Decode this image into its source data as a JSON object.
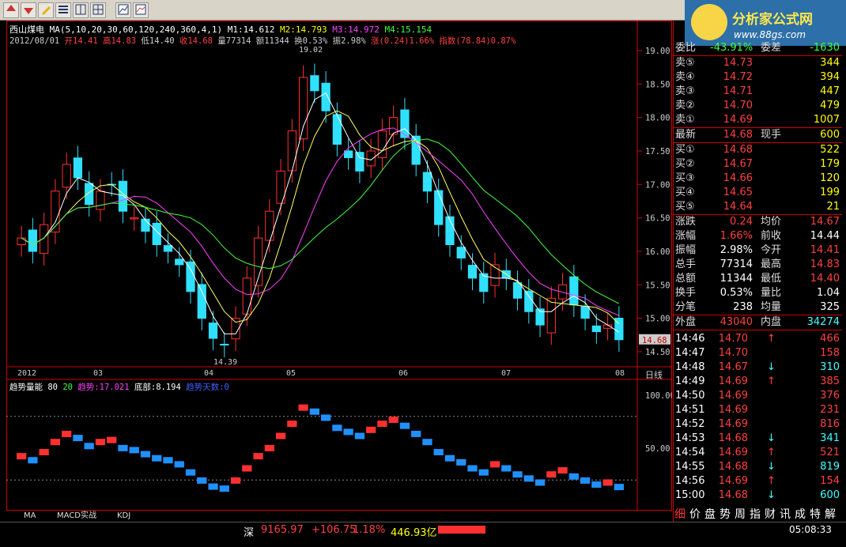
{
  "toolbar": {
    "icons": [
      "arrow-up-icon",
      "arrow-down-icon",
      "pen-icon",
      "list-icon",
      "split-icon",
      "grid-icon",
      "chart-icon",
      "window-icon",
      "graph-icon"
    ]
  },
  "logo": {
    "title": "分析家公式网",
    "url": "www.88gs.com"
  },
  "stock": {
    "name": "西山煤电",
    "ma_params": "MA(5,10,20,30,60,120,240,360,4,1)",
    "m1": "M1:14.612",
    "m2": "M2:14.793",
    "m3": "M3:14.972",
    "m4": "M4:15.154"
  },
  "bar_info": {
    "date": "2012/08/01",
    "open": "开14.41",
    "high": "高14.83",
    "low": "低14.40",
    "close": "收14.68",
    "vol": "量77314",
    "amount": "额11344",
    "turnover": "换0.53%",
    "amp": "振2.98%",
    "change": "涨(0.24)1.66%",
    "index": "指数(78.84)0.87%"
  },
  "indicator": {
    "name": "趋势量能",
    "p1": "80",
    "p2": "20",
    "trend": "趋势:17.021",
    "bottom": "底部:8.194",
    "days": "趋势天数:0"
  },
  "chart_data": {
    "type": "line",
    "title": "西山煤电",
    "y_ticks": [
      "19.00",
      "18.50",
      "18.00",
      "17.50",
      "17.00",
      "16.50",
      "16.00",
      "15.50",
      "15.00",
      "14.50"
    ],
    "annotations": [
      "19.02",
      "14.39"
    ],
    "current_price_tag": "14.68",
    "x_months": [
      "2012",
      "03",
      "04",
      "05",
      "06",
      "07",
      "08"
    ],
    "period": "日线",
    "indicator_ticks": [
      "100.00",
      "50.00"
    ],
    "close_series": [
      16.2,
      16.0,
      16.4,
      16.9,
      17.3,
      17.1,
      16.7,
      16.9,
      17.0,
      16.6,
      16.5,
      16.3,
      16.1,
      16.0,
      15.8,
      15.4,
      15.0,
      14.7,
      14.6,
      15.0,
      15.6,
      16.2,
      16.6,
      17.2,
      17.8,
      18.6,
      18.4,
      18.1,
      17.6,
      17.4,
      17.2,
      17.5,
      17.8,
      18.0,
      17.7,
      17.3,
      16.9,
      16.4,
      16.1,
      15.9,
      15.6,
      15.4,
      15.8,
      15.6,
      15.3,
      15.1,
      14.9,
      15.3,
      15.5,
      15.2,
      15.0,
      14.8,
      14.9,
      14.68
    ]
  },
  "quote": {
    "weibi_label": "委比",
    "weibi_val": "-43.91%",
    "weicha_label": "委差",
    "weicha_val": "-1630",
    "sells": [
      {
        "label": "卖⑤",
        "price": "14.73",
        "vol": "344"
      },
      {
        "label": "卖④",
        "price": "14.72",
        "vol": "394"
      },
      {
        "label": "卖③",
        "price": "14.71",
        "vol": "447"
      },
      {
        "label": "卖②",
        "price": "14.70",
        "vol": "479"
      },
      {
        "label": "卖①",
        "price": "14.69",
        "vol": "1007"
      }
    ],
    "latest": {
      "label": "最新",
      "price": "14.68",
      "label2": "现手",
      "vol": "600"
    },
    "buys": [
      {
        "label": "买①",
        "price": "14.68",
        "vol": "522"
      },
      {
        "label": "买②",
        "price": "14.67",
        "vol": "179"
      },
      {
        "label": "买③",
        "price": "14.66",
        "vol": "120"
      },
      {
        "label": "买④",
        "price": "14.65",
        "vol": "199"
      },
      {
        "label": "买⑤",
        "price": "14.64",
        "vol": "21"
      }
    ],
    "stats": [
      {
        "l1": "涨跌",
        "v1": "0.24",
        "l2": "均价",
        "v2": "14.67"
      },
      {
        "l1": "涨幅",
        "v1": "1.66%",
        "l2": "前收",
        "v2": "14.44"
      },
      {
        "l1": "振幅",
        "v1": "2.98%",
        "l2": "今开",
        "v2": "14.41"
      },
      {
        "l1": "总手",
        "v1": "77314",
        "l2": "最高",
        "v2": "14.83"
      },
      {
        "l1": "总额",
        "v1": "11344",
        "l2": "最低",
        "v2": "14.40"
      },
      {
        "l1": "换手",
        "v1": "0.53%",
        "l2": "量比",
        "v2": "1.04"
      },
      {
        "l1": "分笔",
        "v1": "238",
        "l2": "均量",
        "v2": "325"
      }
    ],
    "outer": {
      "l1": "外盘",
      "v1": "43040",
      "l2": "内盘",
      "v2": "34274"
    },
    "ticks": [
      {
        "t": "14:46",
        "p": "14.70",
        "d": "up",
        "v": "466"
      },
      {
        "t": "14:47",
        "p": "14.70",
        "d": "",
        "v": "158"
      },
      {
        "t": "14:48",
        "p": "14.67",
        "d": "down",
        "v": "310"
      },
      {
        "t": "14:49",
        "p": "14.69",
        "d": "up",
        "v": "385"
      },
      {
        "t": "14:50",
        "p": "14.69",
        "d": "",
        "v": "376"
      },
      {
        "t": "14:51",
        "p": "14.69",
        "d": "",
        "v": "231"
      },
      {
        "t": "14:52",
        "p": "14.69",
        "d": "",
        "v": "816"
      },
      {
        "t": "14:53",
        "p": "14.68",
        "d": "down",
        "v": "341"
      },
      {
        "t": "14:54",
        "p": "14.69",
        "d": "up",
        "v": "521"
      },
      {
        "t": "14:55",
        "p": "14.68",
        "d": "down",
        "v": "819"
      },
      {
        "t": "14:56",
        "p": "14.69",
        "d": "up",
        "v": "154"
      },
      {
        "t": "15:00",
        "p": "14.68",
        "d": "down",
        "v": "600"
      }
    ]
  },
  "bottom_tabs": [
    "细",
    "价",
    "盘",
    "势",
    "周",
    "指",
    "财",
    "讯",
    "成",
    "特",
    "解"
  ],
  "indicator_tabs": [
    "MA",
    "MACD实战",
    "KDJ"
  ],
  "status": {
    "market": "深",
    "index": "9165.97",
    "change": "+106.75",
    "pct": "1.18%",
    "amount": "446.93亿",
    "time": "05:08:33"
  },
  "colors": {
    "up": "#ff3030",
    "down": "#30e0ff",
    "ma5": "#ffffff",
    "ma10": "#ffff60",
    "ma20": "#ff40ff",
    "ma30": "#40ff40"
  }
}
